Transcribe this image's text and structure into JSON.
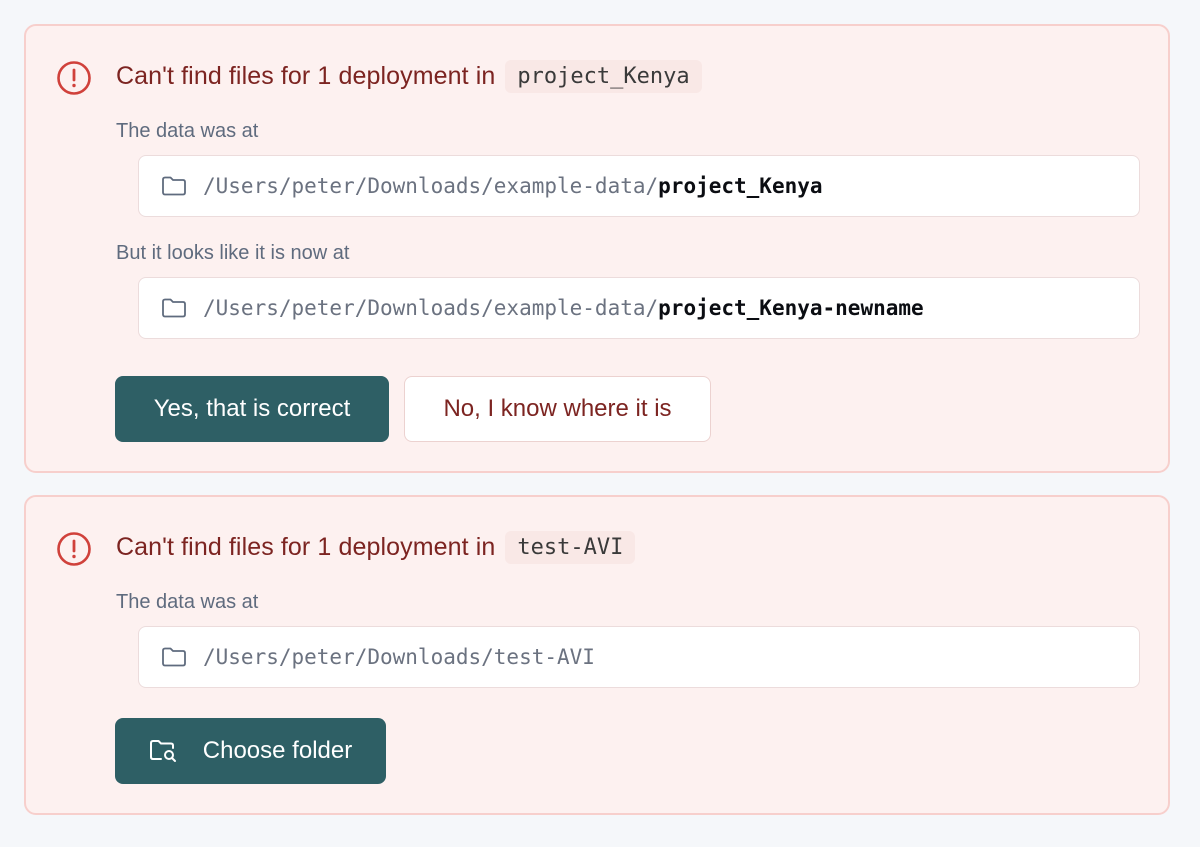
{
  "cards": [
    {
      "title": "Can't find files for 1 deployment in",
      "project": "project_Kenya",
      "old_label": "The data was at",
      "old_path_prefix": "/Users/peter/Downloads/example-data/",
      "old_path_name": "project_Kenya",
      "new_label": "But it looks like it is now at",
      "new_path_prefix": "/Users/peter/Downloads/example-data/",
      "new_path_name": "project_Kenya-newname",
      "confirm_label": "Yes, that is correct",
      "deny_label": "No, I know where it is"
    },
    {
      "title": "Can't find files for 1 deployment in",
      "project": "test-AVI",
      "old_label": "The data was at",
      "old_path_prefix": "/Users/peter/Downloads/test-AVI",
      "choose_label": "Choose folder"
    }
  ],
  "icons": {
    "alert": "alert-circle-icon",
    "folder": "folder-icon",
    "folder_search": "folder-search-icon"
  },
  "colors": {
    "card_bg": "#fdf1f0",
    "card_border": "#f7cfcc",
    "alert_red": "#d0413b",
    "title_red": "#7c2421",
    "primary_button": "#2e5f65"
  }
}
